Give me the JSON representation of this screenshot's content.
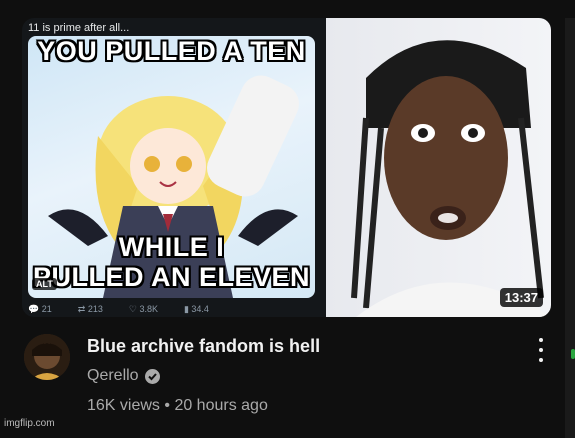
{
  "video": {
    "thumbnail": {
      "tweet_text": "11 is prime after all...",
      "meme_top": "YOU PULLED A TEN",
      "meme_bottom_1": "WHILE I",
      "meme_bottom_2": "PULLED AN ELEVEN",
      "alt_badge": "ALT",
      "stats": {
        "replies": "21",
        "reposts": "213",
        "likes": "3.8K",
        "views": "34.4"
      },
      "duration": "13:37"
    },
    "title": "Blue archive fandom is hell",
    "channel": "Qerello",
    "views": "16K views",
    "separator": "•",
    "age": "20 hours ago"
  },
  "watermark": "imgflip.com"
}
